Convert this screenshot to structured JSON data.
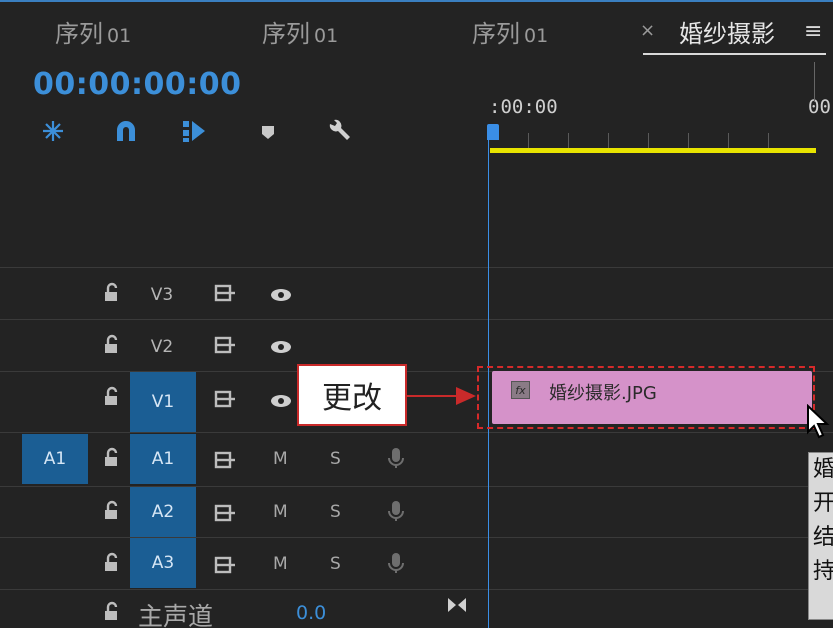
{
  "tabs": [
    {
      "label": "序列",
      "num": "01"
    },
    {
      "label": "序列",
      "num": "01"
    },
    {
      "label": "序列",
      "num": "01"
    },
    {
      "label": "婚纱摄影",
      "num": ""
    }
  ],
  "tab_close": "×",
  "tab_menu": "≡",
  "timecode": "00:00:00:00",
  "ruler": {
    "start_label": ":00:00",
    "end_label": "00"
  },
  "tools": [
    "snap-icon",
    "magnet-icon",
    "linked-selection-icon",
    "marker-icon",
    "wrench-icon"
  ],
  "video_tracks": [
    {
      "name": "V3",
      "targeted": false
    },
    {
      "name": "V2",
      "targeted": false
    },
    {
      "name": "V1",
      "targeted": true
    }
  ],
  "audio_tracks": [
    {
      "name": "A1",
      "source": "A1",
      "targeted": true
    },
    {
      "name": "A2",
      "source": "",
      "targeted": true
    },
    {
      "name": "A3",
      "source": "",
      "targeted": true
    }
  ],
  "mute_label": "M",
  "solo_label": "S",
  "clip": {
    "name": "婚纱摄影.JPG",
    "fx": "fx",
    "color": "#d592c9"
  },
  "callout": {
    "text": "更改"
  },
  "tooltip": {
    "lines": [
      "婚",
      "开",
      "结",
      "持"
    ]
  },
  "master": {
    "label": "主声道",
    "value": "0.0"
  },
  "colors": {
    "accent": "#3c8fd9",
    "track_target": "#1b5e94",
    "workbar": "#e8e400",
    "annotation": "#c92a2a"
  }
}
